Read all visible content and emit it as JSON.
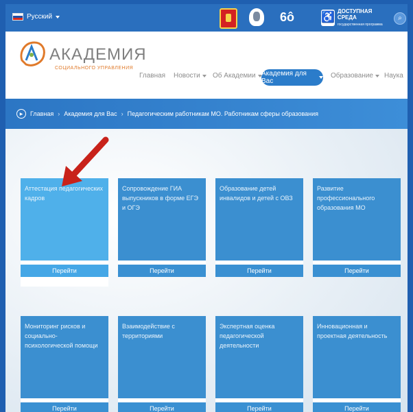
{
  "topbar": {
    "language": "Русский",
    "accessibility_title": "ДОСТУПНАЯ",
    "accessibility_title2": "СРЕДА",
    "accessibility_small": "государственная программа"
  },
  "logo": {
    "title": "АКАДЕМИЯ",
    "subtitle": "СОЦИАЛЬНОГО УПРАВЛЕНИЯ"
  },
  "nav": {
    "items": [
      "Главная",
      "Новости",
      "Об Академии",
      "Академия для Вас",
      "Образование",
      "Наука"
    ],
    "active": "Академия для Вас"
  },
  "breadcrumb": [
    "Главная",
    "Академия для Вас",
    "Педагогическим работникам МО. Работникам сферы образования"
  ],
  "cards": [
    {
      "title": "Аттестация педагогических кадров",
      "button": "Перейти"
    },
    {
      "title": "Сопровождение ГИА выпускников в форме ЕГЭ и ОГЭ",
      "button": "Перейти"
    },
    {
      "title": "Образование детей инвалидов и детей с ОВЗ",
      "button": "Перейти"
    },
    {
      "title": "Развитие профессионального образования МО",
      "button": "Перейти"
    },
    {
      "title": "Мониторинг рисков и социально-психологической помощи",
      "button": "Перейти"
    },
    {
      "title": "Взаимодействие с территориями",
      "button": "Перейти"
    },
    {
      "title": "Экспертная оценка педагогической деятельности",
      "button": "Перейти"
    },
    {
      "title": "Инновационная и проектная деятельность",
      "button": "Перейти"
    }
  ],
  "colors": {
    "brand_blue": "#2b7cca",
    "card_blue": "#3b8fd0",
    "card_highlight": "#4fb0ea",
    "arrow_red": "#c8221a",
    "logo_orange": "#e07a2a"
  }
}
